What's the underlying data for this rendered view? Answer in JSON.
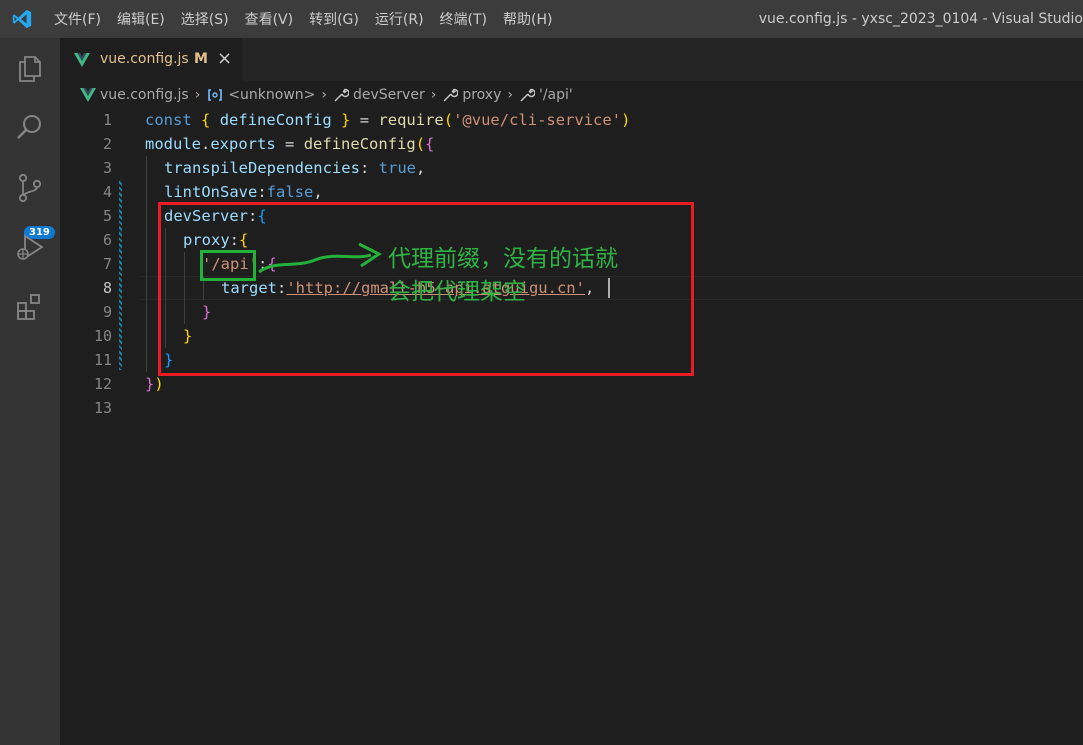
{
  "menu": [
    "文件(F)",
    "编辑(E)",
    "选择(S)",
    "查看(V)",
    "转到(G)",
    "运行(R)",
    "终端(T)",
    "帮助(H)"
  ],
  "window_title": "vue.config.js - yxsc_2023_0104 - Visual Studio",
  "activity": {
    "scm_badge": "319"
  },
  "tab": {
    "name": "vue.config.js",
    "status": "M",
    "close": "×"
  },
  "breadcrumbs": {
    "file": "vue.config.js",
    "unknown": "<unknown>",
    "devserver": "devServer",
    "proxy": "proxy",
    "api": "'/api'",
    "sep": "›"
  },
  "line_numbers": [
    "1",
    "2",
    "3",
    "4",
    "5",
    "6",
    "7",
    "8",
    "9",
    "10",
    "11",
    "12",
    "13"
  ],
  "code": {
    "l1": {
      "kw": "const",
      "b1": "{",
      "name": "defineConfig",
      "b2": "}",
      "eq": "=",
      "fn": "require",
      "p1": "(",
      "str": "'@vue/cli-service'",
      "p2": ")"
    },
    "l2": {
      "obj": "module",
      "dot": ".",
      "prop": "exports",
      "eq": "=",
      "fn": "defineConfig",
      "p1": "(",
      "b1": "{"
    },
    "l3": {
      "key": "transpileDependencies",
      "colon": ":",
      "val": "true",
      "comma": ","
    },
    "l4": {
      "key": "lintOnSave",
      "colon": ":",
      "val": "false",
      "comma": ","
    },
    "l5": {
      "key": "devServer",
      "colon": ":",
      "b": "{"
    },
    "l6": {
      "key": "proxy",
      "colon": ":",
      "b": "{"
    },
    "l7": {
      "key": "'/api'",
      "colon": ":",
      "b": "{"
    },
    "l8": {
      "key": "target",
      "colon": ":",
      "val": "'http://gmall-h5-api.atguigu.cn'",
      "comma": ","
    },
    "l9": {
      "b": "}"
    },
    "l10": {
      "b": "}"
    },
    "l11": {
      "b": "}"
    },
    "l12": {
      "b": "}",
      "p": ")"
    }
  },
  "annotation": {
    "line1": "代理前缀，没有的话就",
    "line2": "会把代理架空"
  },
  "colors": {
    "red_box": "#e81c24",
    "green_box": "#24b13a",
    "annotation": "#2fb344"
  }
}
